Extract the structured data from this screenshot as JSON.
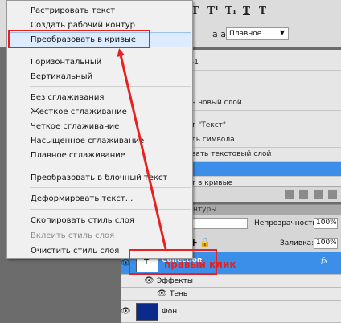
{
  "toolbar": {
    "style_buttons": [
      "T",
      "T¹",
      "T₁",
      "T",
      "Ŧ"
    ],
    "aa_icon": "a a",
    "antialias_value": "Плавное"
  },
  "history": {
    "rows": [
      "-1",
      "ь новый слой",
      "т \"Текст\"",
      "ль символа",
      "вать текстовый слой",
      "",
      "т в кривые"
    ]
  },
  "layers": {
    "tab_label": "нтуры",
    "opacity_label": "Непрозрачность:",
    "opacity_value": "100%",
    "fill_label": "Заливка:",
    "fill_value": "100%",
    "rows": {
      "collection": "Collection",
      "effects": "Эффекты",
      "shadow": "Тень",
      "background": "Фон"
    },
    "fx": "fx"
  },
  "context_menu": {
    "items": [
      {
        "label": "Растрировать текст"
      },
      {
        "label": "Создать рабочий контур"
      },
      {
        "label": "Преобразовать в кривые",
        "highlighted": true
      },
      {
        "label": "Горизонтальный"
      },
      {
        "label": "Вертикальный"
      },
      {
        "label": "Без сглаживания"
      },
      {
        "label": "Жесткое сглаживание"
      },
      {
        "label": "Четкое сглаживание"
      },
      {
        "label": "Насыщенное сглаживание"
      },
      {
        "label": "Плавное сглаживание"
      },
      {
        "label": "Преобразовать в блочный текст"
      },
      {
        "label": "Деформировать текст..."
      },
      {
        "label": "Скопировать стиль слоя"
      },
      {
        "label": "Вклеить стиль слоя",
        "disabled": true
      },
      {
        "label": "Очистить стиль слоя"
      }
    ]
  },
  "annotation": {
    "label": "правый клик",
    "color": "#e82020"
  },
  "colors": {
    "selection": "#3b8fe8",
    "background_layer_thumb": "#0b2a8a"
  }
}
